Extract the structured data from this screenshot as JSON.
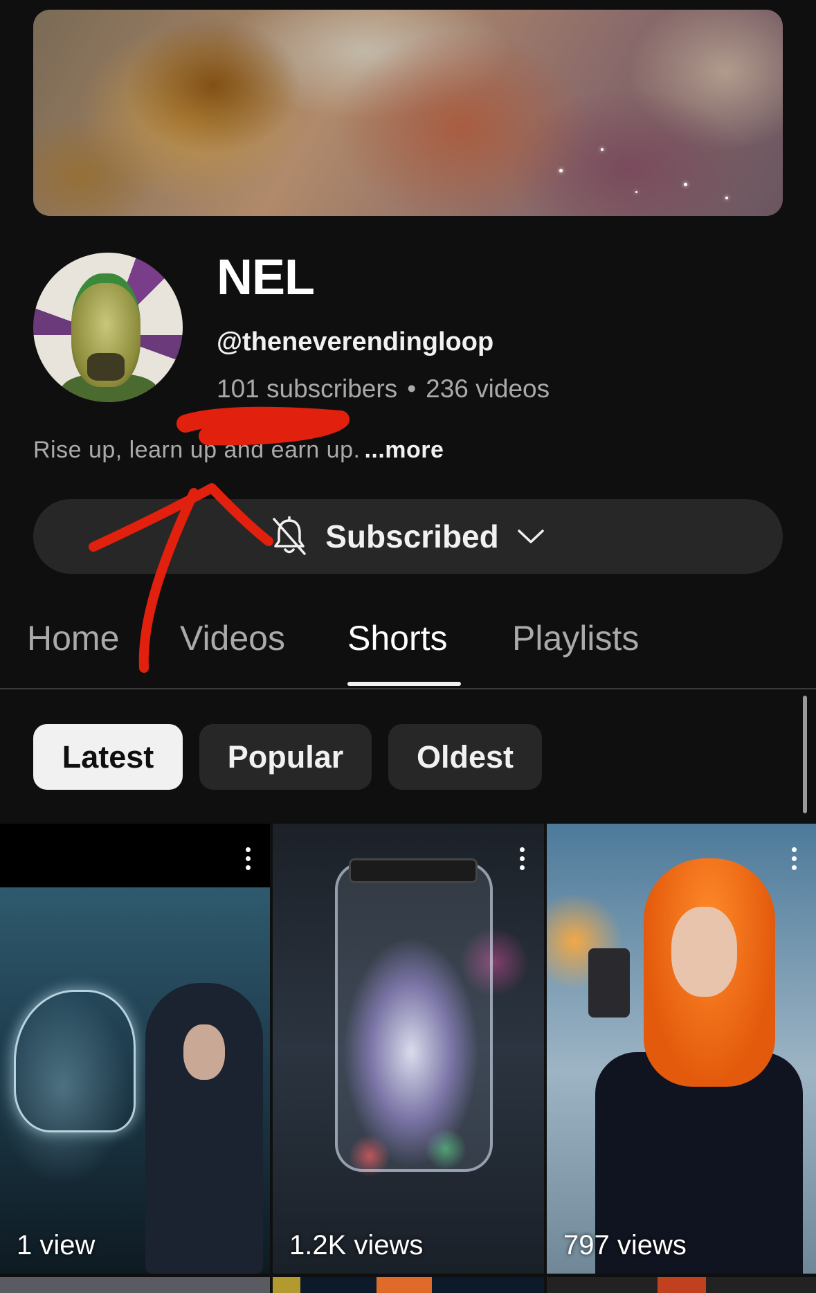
{
  "channel": {
    "name": "NEL",
    "handle": "@theneverendingloop",
    "subscribers": "101 subscribers",
    "separator": "•",
    "videos": "236 videos",
    "description": "Rise up, learn up and earn up.",
    "more_label": "...more"
  },
  "subscribe_button": {
    "label": "Subscribed",
    "bell_icon": "bell-off-icon",
    "chevron_icon": "chevron-down-icon"
  },
  "tabs": [
    {
      "label": "Home",
      "selected": false
    },
    {
      "label": "Videos",
      "selected": false
    },
    {
      "label": "Shorts",
      "selected": true
    },
    {
      "label": "Playlists",
      "selected": false
    }
  ],
  "filters": [
    {
      "label": "Latest",
      "selected": true
    },
    {
      "label": "Popular",
      "selected": false
    },
    {
      "label": "Oldest",
      "selected": false
    }
  ],
  "shorts": [
    {
      "views": "1 view"
    },
    {
      "views": "1.2K views"
    },
    {
      "views": "797 views"
    }
  ],
  "colors": {
    "background": "#0f0f0f",
    "chip_selected": "#f1f1f1",
    "chip_default": "#272727",
    "annotation": "#e1200e"
  }
}
